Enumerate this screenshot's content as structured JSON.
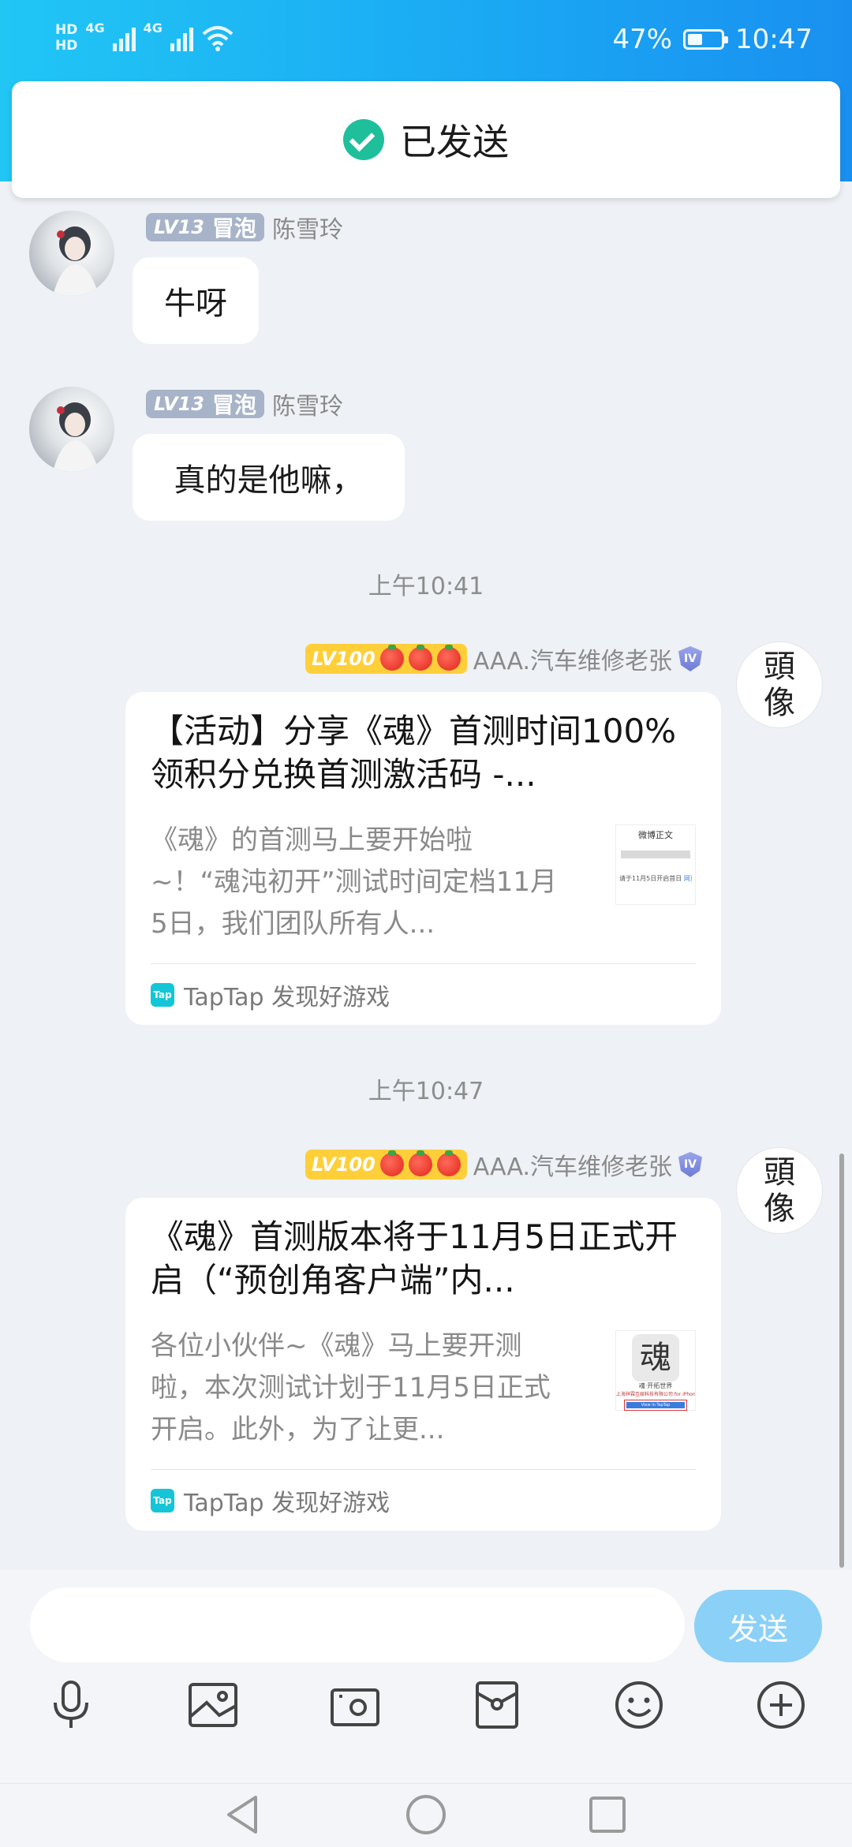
{
  "status_bar": {
    "hd1": "HD",
    "hd2": "HD",
    "net1": "4G",
    "net2": "4G",
    "battery": "47%",
    "time": "10:47"
  },
  "toast": {
    "text": "已发送"
  },
  "messages": [
    {
      "level": "LV13",
      "bubble_tag": "冒泡",
      "sender": "陈雪玲",
      "text": "牛呀"
    },
    {
      "level": "LV13",
      "bubble_tag": "冒泡",
      "sender": "陈雪玲",
      "text": "真的是他嘛，"
    }
  ],
  "timestamp1": "上午10:41",
  "timestamp2": "上午10:47",
  "self": {
    "level": "LV100",
    "sender": "AAA.汽车维修老张",
    "shield": "IV",
    "avatar_text_1": "頭",
    "avatar_text_2": "像"
  },
  "cards": [
    {
      "title": "【活动】分享《魂》首测时间100%领积分兑换首测激活码 -...",
      "desc": "《魂》的首测马上要开始啦~！“魂沌初开”测试时间定档11月5日，我们团队所有人...",
      "thumb_title": "微博正文",
      "thumb_caption": "请于11月5日开启首日",
      "thumb_link": "网页链接",
      "source": "TapTap 发现好游戏",
      "source_logo": "Tap"
    },
    {
      "title": "《魂》首测版本将于11月5日正式开启（“预创角客户端”内...",
      "desc": "各位小伙伴~《魂》马上要开测啦，本次测试计划于11月5日正式开启。此外，为了让更...",
      "thumb_glyph": "魂",
      "thumb_caption1": "魂·开拓世界",
      "thumb_caption2": "上海祥霖互娱科技有限公司 for iPhone",
      "thumb_button": "View in TapTap",
      "source": "TapTap 发现好游戏",
      "source_logo": "Tap"
    }
  ],
  "input": {
    "placeholder": "",
    "send_label": "发送"
  },
  "toolbar": [
    "microphone-icon",
    "image-icon",
    "camera-icon",
    "red-packet-icon",
    "emoji-icon",
    "plus-icon"
  ],
  "colors": {
    "accent": "#1aa7f3",
    "send": "#8bd0f7",
    "toast_check": "#1fbf9c",
    "badge": "#a7b3c8",
    "gold": "#ffcf3a"
  }
}
